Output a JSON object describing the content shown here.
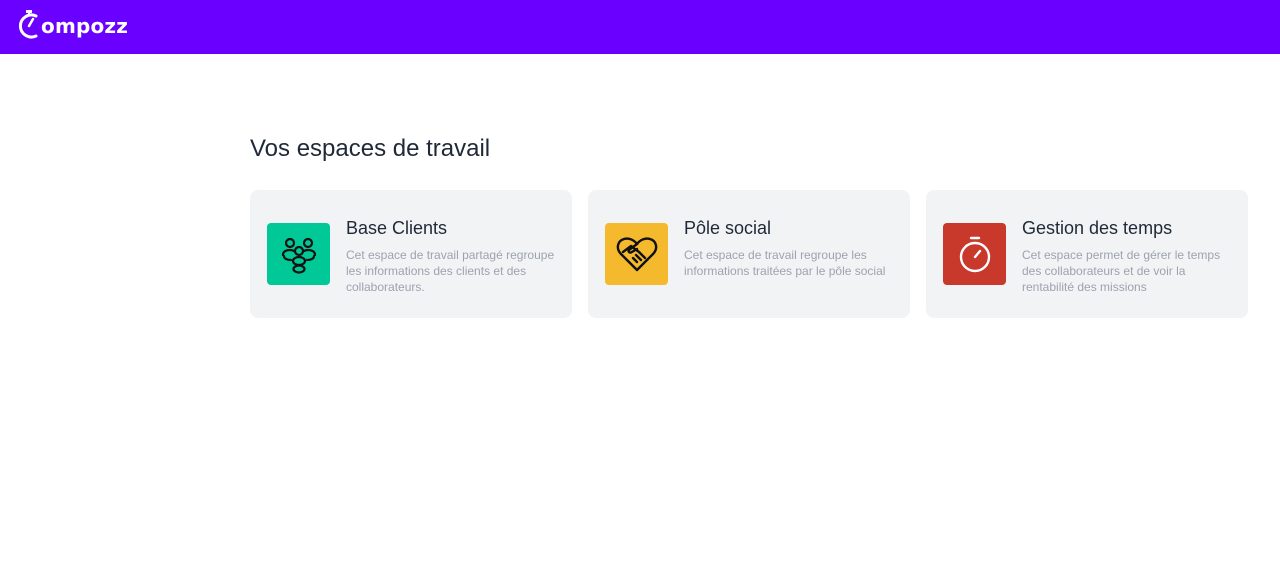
{
  "header": {
    "logo_text": "ompozz",
    "background": "#6a00ff"
  },
  "main": {
    "title": "Vos espaces de travail",
    "workspaces": [
      {
        "title": "Base Clients",
        "description": "Cet espace de travail partagé regroupe les informations des clients et des collaborateurs.",
        "icon": "users-group-icon",
        "color": "#00c896"
      },
      {
        "title": "Pôle social",
        "description": "Cet espace de travail regroupe les informations traitées par le pôle social",
        "icon": "heart-handshake-icon",
        "color": "#f4b92c"
      },
      {
        "title": "Gestion des temps",
        "description": "Cet espace permet de gérer le temps des collaborateurs et de voir la rentabilité des missions",
        "icon": "stopwatch-icon",
        "color": "#c9392b"
      }
    ]
  }
}
